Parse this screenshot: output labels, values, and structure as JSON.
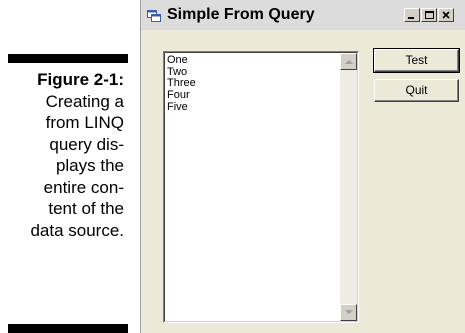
{
  "caption": {
    "figure_label": "Figure 2-1:",
    "lines": [
      "Creating a",
      "from LINQ",
      "query dis-",
      "plays the",
      "entire con-",
      "tent of the",
      "data source."
    ]
  },
  "window": {
    "title": "Simple From Query",
    "app_icon": "form-icon",
    "controls": {
      "minimize": "minimize-icon",
      "maximize": "maximize-icon",
      "close": "close-icon"
    }
  },
  "listbox": {
    "items": [
      "One",
      "Two",
      "Three",
      "Four",
      "Five"
    ]
  },
  "buttons": {
    "test_label": "Test",
    "quit_label": "Quit"
  }
}
